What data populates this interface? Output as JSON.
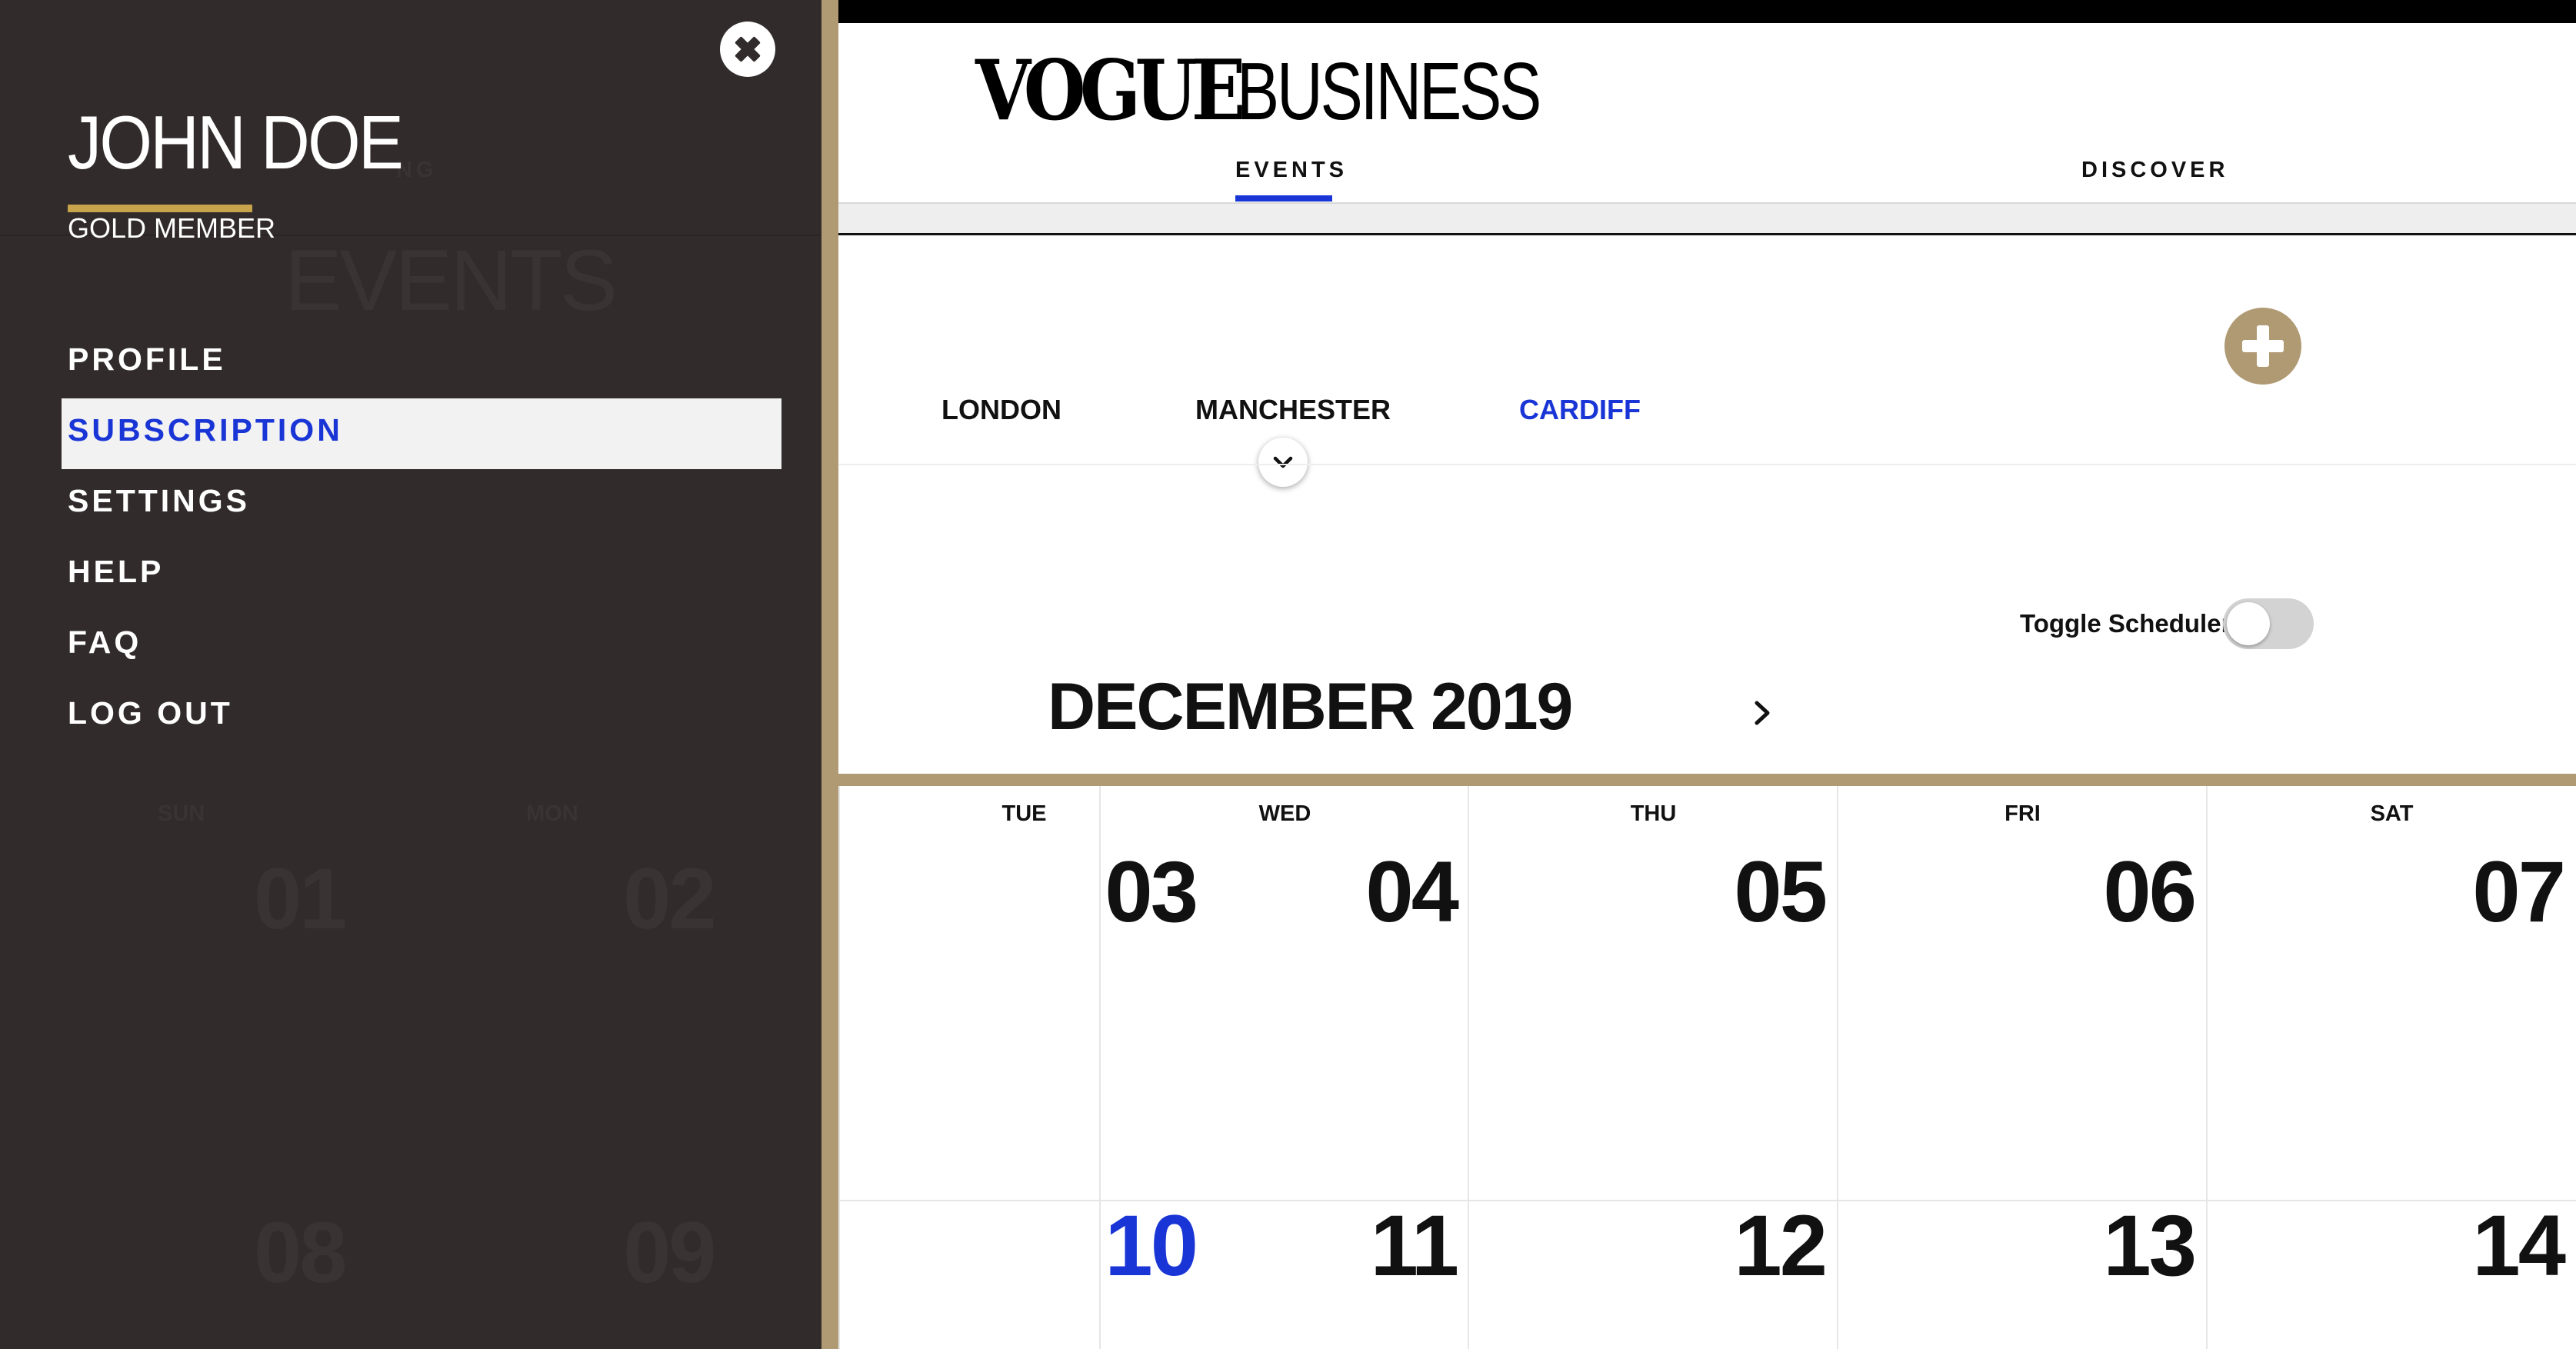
{
  "brand": {
    "name_part1": "VOGUE",
    "name_part2": "BUSINESS"
  },
  "nav": {
    "tabs": [
      {
        "label": "EVENTS",
        "active": true
      },
      {
        "label": "DISCOVER",
        "active": false
      }
    ]
  },
  "cities": [
    {
      "label": "LONDON",
      "selected": false
    },
    {
      "label": "MANCHESTER",
      "selected": false
    },
    {
      "label": "CARDIFF",
      "selected": true
    }
  ],
  "scheduler": {
    "toggle_label": "Toggle Scheduler",
    "enabled": false
  },
  "calendar": {
    "month_label": "DECEMBER 2019",
    "days": [
      {
        "name": "TUE",
        "week1": "03",
        "week2": "10",
        "today": true
      },
      {
        "name": "WED",
        "week1": "04",
        "week2": "11"
      },
      {
        "name": "THU",
        "week1": "05",
        "week2": "12"
      },
      {
        "name": "FRI",
        "week1": "06",
        "week2": "13"
      },
      {
        "name": "SAT",
        "week1": "07",
        "week2": "14"
      }
    ],
    "hidden": {
      "days": [
        {
          "name": "SUN",
          "week1": "01",
          "week2": "08"
        },
        {
          "name": "MON",
          "week1": "02",
          "week2": "09"
        }
      ],
      "title": "EVENTS",
      "tab": "NG"
    }
  },
  "overlay": {
    "user_name": "JOHN DOE",
    "member_level": "GOLD MEMBER",
    "menu": [
      {
        "label": "PROFILE",
        "active": false
      },
      {
        "label": "SUBSCRIPTION",
        "active": true
      },
      {
        "label": "SETTINGS",
        "active": false
      },
      {
        "label": "HELP",
        "active": false
      },
      {
        "label": "FAQ",
        "active": false
      },
      {
        "label": "LOG OUT",
        "active": false
      }
    ]
  },
  "colors": {
    "accent_blue": "#1a35d6",
    "gold": "#b09a74",
    "overlay_bg": "#312b2c"
  }
}
